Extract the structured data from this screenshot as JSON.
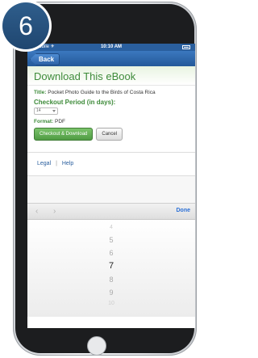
{
  "step_badge": "6",
  "status": {
    "carrier": "T-Mobile ✈",
    "time": "10:10 AM"
  },
  "nav": {
    "back_label": "Back"
  },
  "page": {
    "title": "Download This eBook",
    "title_label": "Title:",
    "title_value": "Pocket Photo Guide to the Birds of Costa Rica",
    "checkout_label": "Checkout Period (in days):",
    "checkout_value": "14",
    "format_label": "Format:",
    "format_value": "PDF",
    "checkout_button": "Checkout & Download",
    "cancel_button": "Cancel"
  },
  "footer": {
    "legal": "Legal",
    "separator": "|",
    "help": "Help"
  },
  "keyboard": {
    "prev": "‹",
    "next": "›",
    "done": "Done"
  },
  "picker": {
    "options": [
      "4",
      "5",
      "6",
      "7",
      "8",
      "9",
      "10"
    ],
    "selected": "7"
  }
}
